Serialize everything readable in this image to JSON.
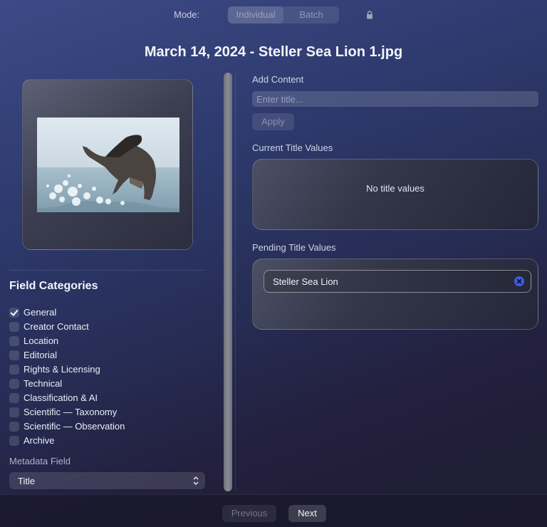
{
  "header": {
    "mode_label": "Mode:",
    "modes": [
      "Individual",
      "Batch"
    ],
    "active_mode": "Individual",
    "lock_icon": "lock-icon",
    "title": "March 14, 2024 - Steller Sea Lion 1.jpg"
  },
  "preview": {
    "image_subject": "Steller sea lion breaching out of water"
  },
  "categories": {
    "heading": "Field Categories",
    "items": [
      {
        "label": "General",
        "checked": true
      },
      {
        "label": "Creator Contact",
        "checked": false
      },
      {
        "label": "Location",
        "checked": false
      },
      {
        "label": "Editorial",
        "checked": false
      },
      {
        "label": "Rights & Licensing",
        "checked": false
      },
      {
        "label": "Technical",
        "checked": false
      },
      {
        "label": "Classification & AI",
        "checked": false
      },
      {
        "label": "Scientific — Taxonomy",
        "checked": false
      },
      {
        "label": "Scientific — Observation",
        "checked": false
      },
      {
        "label": "Archive",
        "checked": false
      }
    ]
  },
  "metadata_field": {
    "label": "Metadata Field",
    "selected": "Title"
  },
  "add_content": {
    "label": "Add Content",
    "placeholder": "Enter title...",
    "value": "",
    "apply_label": "Apply"
  },
  "current_values": {
    "label": "Current Title Values",
    "empty_message": "No title values"
  },
  "pending_values": {
    "label": "Pending Title Values",
    "items": [
      "Steller Sea Lion"
    ]
  },
  "footer": {
    "previous_label": "Previous",
    "next_label": "Next"
  },
  "colors": {
    "remove_accent": "#3d5de0",
    "background_top": "#3d4a86",
    "background_bottom": "#1f1d33"
  }
}
